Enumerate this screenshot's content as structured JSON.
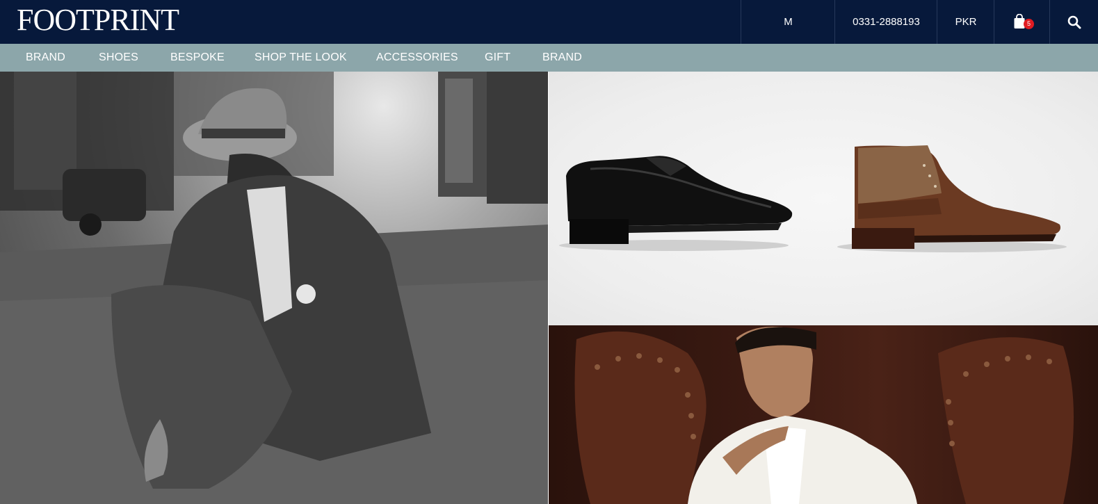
{
  "header": {
    "logo_text": "FOOTPRINT",
    "user_label": "M",
    "phone": "0331-2888193",
    "currency": "PKR",
    "cart_count": "5",
    "icons": {
      "cart": "shopping-bag-icon",
      "search": "search-icon"
    },
    "colors": {
      "header_bg": "#07193b",
      "nav_bg": "#8ca6aa",
      "badge": "#e01b22"
    }
  },
  "nav": {
    "items": [
      {
        "label": "BRAND"
      },
      {
        "label": "SHOES"
      },
      {
        "label": "BESPOKE"
      },
      {
        "label": "SHOP THE LOOK"
      },
      {
        "label": "ACCESSORIES"
      },
      {
        "label": "GIFT"
      },
      {
        "label": "BRAND"
      }
    ]
  },
  "hero": {
    "left_image": "man-in-hat-kneeling-photo",
    "shoes_image": "oxford-and-chukka-shoes-photo",
    "bottom_image": "man-on-leather-chesterfield-photo"
  }
}
